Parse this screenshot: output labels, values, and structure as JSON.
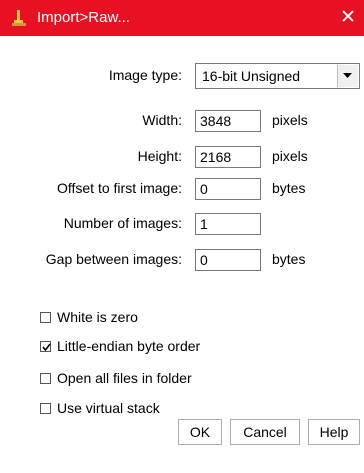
{
  "window": {
    "title": "Import>Raw...",
    "close_glyph": "✕"
  },
  "form": {
    "image_type": {
      "label": "Image type:",
      "value": "16-bit Unsigned"
    },
    "width": {
      "label": "Width:",
      "value": "3848",
      "unit": "pixels"
    },
    "height": {
      "label": "Height:",
      "value": "2168",
      "unit": "pixels"
    },
    "offset": {
      "label": "Offset to first image:",
      "value": "0",
      "unit": "bytes"
    },
    "num_images": {
      "label": "Number of images:",
      "value": "1"
    },
    "gap": {
      "label": "Gap between images:",
      "value": "0",
      "unit": "bytes"
    }
  },
  "options": [
    {
      "label": "White is zero",
      "checked": false
    },
    {
      "label": "Little-endian byte order",
      "checked": true
    },
    {
      "label": "Open all files in folder",
      "checked": false
    },
    {
      "label": "Use virtual stack",
      "checked": false
    }
  ],
  "buttons": {
    "ok": "OK",
    "cancel": "Cancel",
    "help": "Help"
  },
  "colors": {
    "titlebar": "#e81123"
  }
}
